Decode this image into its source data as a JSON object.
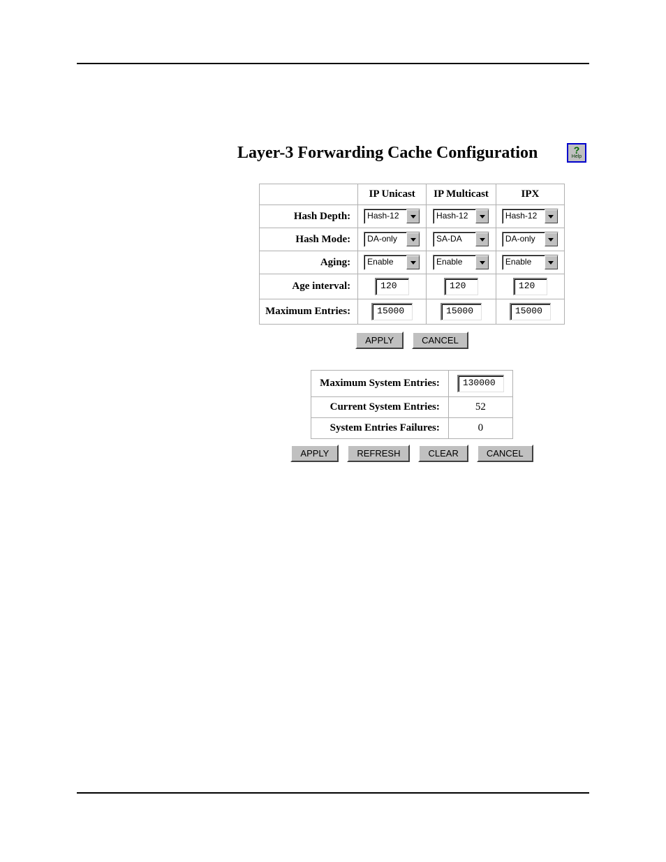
{
  "title": "Layer-3 Forwarding Cache Configuration",
  "help": {
    "q": "?",
    "label": "Help"
  },
  "columns": [
    "IP Unicast",
    "IP Multicast",
    "IPX"
  ],
  "rows": {
    "hash_depth": {
      "label": "Hash Depth:",
      "values": [
        "Hash-12",
        "Hash-12",
        "Hash-12"
      ]
    },
    "hash_mode": {
      "label": "Hash Mode:",
      "values": [
        "DA-only",
        "SA-DA",
        "DA-only"
      ]
    },
    "aging": {
      "label": "Aging:",
      "values": [
        "Enable",
        "Enable",
        "Enable"
      ]
    },
    "age_interval": {
      "label": "Age interval:",
      "values": [
        "120",
        "120",
        "120"
      ]
    },
    "max_entries": {
      "label": "Maximum Entries:",
      "values": [
        "15000",
        "15000",
        "15000"
      ]
    }
  },
  "buttons_top": {
    "apply": "APPLY",
    "cancel": "CANCEL"
  },
  "system": {
    "max_entries": {
      "label": "Maximum System Entries:",
      "value": "130000"
    },
    "current_entries": {
      "label": "Current System Entries:",
      "value": "52"
    },
    "entries_failures": {
      "label": "System Entries Failures:",
      "value": "0"
    }
  },
  "buttons_bottom": {
    "apply": "APPLY",
    "refresh": "REFRESH",
    "clear": "CLEAR",
    "cancel": "CANCEL"
  }
}
